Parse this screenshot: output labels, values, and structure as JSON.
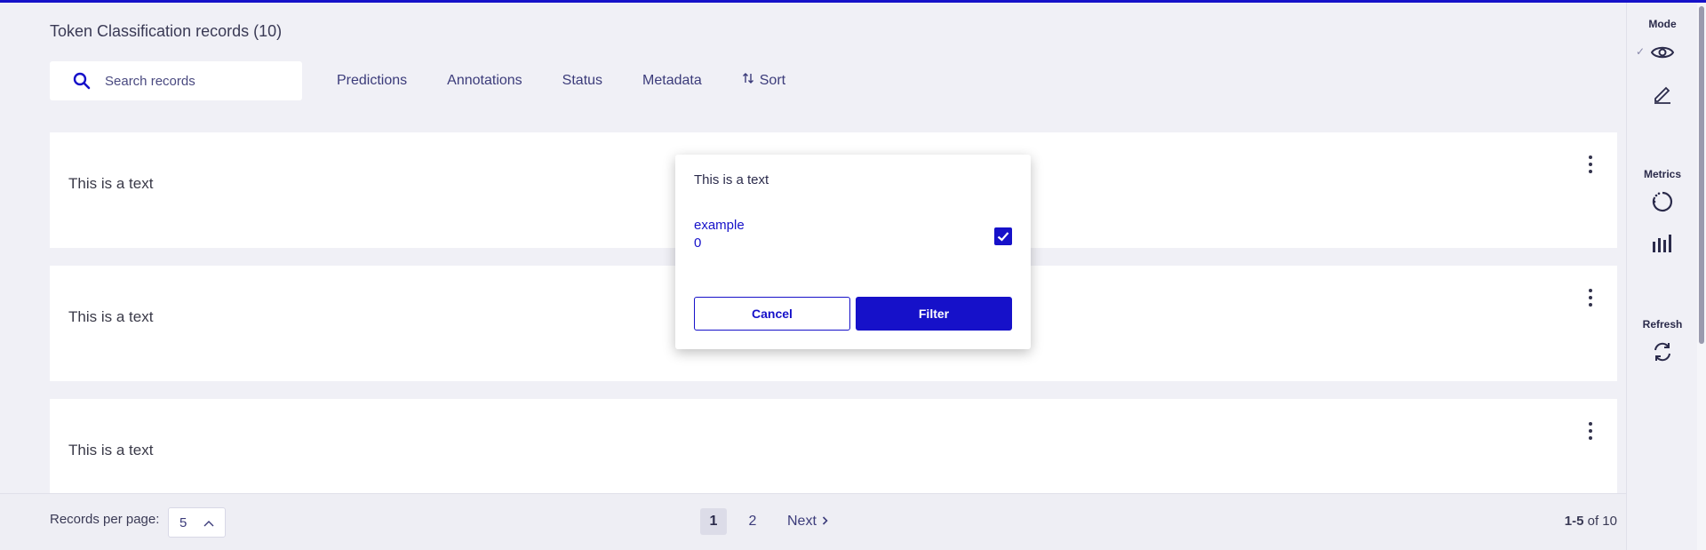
{
  "header": {
    "title": "Token Classification records (10)"
  },
  "search": {
    "placeholder": "Search records",
    "icon": "search-icon"
  },
  "filters": [
    {
      "label": "Predictions"
    },
    {
      "label": "Annotations"
    },
    {
      "label": "Status"
    },
    {
      "label": "Metadata"
    },
    {
      "label": "Sort",
      "icon": "sort-arrows-icon"
    }
  ],
  "records": [
    {
      "text": "This is a text"
    },
    {
      "text": "This is a text"
    },
    {
      "text": "This is a text"
    }
  ],
  "popup": {
    "title": "This is a text",
    "option": {
      "label": "example",
      "count": "0",
      "checked": true
    },
    "cancel_label": "Cancel",
    "filter_label": "Filter"
  },
  "footer": {
    "records_per_page_label": "Records per page:",
    "records_per_page_value": "5",
    "pages": [
      "1",
      "2"
    ],
    "current_page": "1",
    "next_label": "Next",
    "range": "1-5",
    "of_label": "of 10"
  },
  "sidebar": {
    "mode_title": "Mode",
    "metrics_title": "Metrics",
    "refresh_title": "Refresh",
    "icons": [
      "eye-icon",
      "pencil-icon",
      "progress-ring-icon",
      "bar-chart-icon",
      "refresh-icon"
    ]
  },
  "colors": {
    "accent": "#1611c9",
    "background": "#f0f0f6",
    "card": "#ffffff"
  }
}
